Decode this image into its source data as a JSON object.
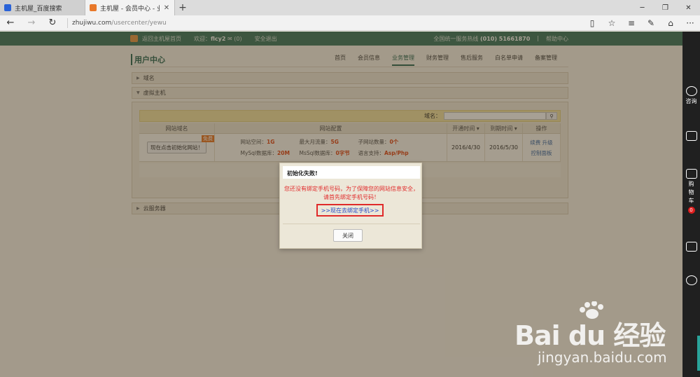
{
  "browser": {
    "tabs": [
      {
        "title": "主机屋_百度搜索",
        "favicon": "baidu-paw-icon"
      },
      {
        "title": "主机屋 - 会员中心 - 业务",
        "favicon": "house-icon"
      }
    ],
    "new_tab": "+",
    "url_host": "zhujiwu.com",
    "url_path": "/usercenter/yewu"
  },
  "site_header": {
    "home_link": "返回主机屋首页",
    "welcome": "欢迎：",
    "username": "flcy2",
    "message_count": "(0)",
    "logout": "安全退出",
    "hotline_label": "全国统一服务热线",
    "hotline": "(010) 51661870",
    "help": "帮助中心"
  },
  "user_center": {
    "title": "用户中心",
    "nav": [
      "首页",
      "会员信息",
      "业务管理",
      "财务管理",
      "售后服务",
      "白名单申请",
      "备案管理"
    ],
    "active_nav": "业务管理"
  },
  "sections": {
    "domain": "域名",
    "vhost": "虚拟主机",
    "cloud": "云服务器"
  },
  "hosting": {
    "search_label": "域名：",
    "columns": [
      "网站域名",
      "网站配置",
      "开通时间 ▾",
      "到期时间 ▾",
      "操作"
    ],
    "row": {
      "init_button": "现在点击初始化网站！",
      "badge": "免费",
      "space_label": "网站空间：",
      "space": "1G",
      "traffic_label": "最大月流量：",
      "traffic": "5G",
      "subsites_label": "子网站数量：",
      "subsites": "0个",
      "mysql_label": "MySql数据库：",
      "mysql": "20M",
      "mssql_label": "MsSql数据库：",
      "mssql": "0字节",
      "lang_label": "语言支持：",
      "lang": "Asp/Php",
      "open_date": "2016/4/30",
      "expire_date": "2016/5/30",
      "ops_1": "续费 升级",
      "ops_2": "控制面板"
    }
  },
  "dialog": {
    "title": "初始化失败!",
    "message": "您还没有绑定手机号码，为了保障您的网站信息安全，请首先绑定手机号码！",
    "link": ">>现在去绑定手机>>",
    "close": "关闭"
  },
  "sidebar": {
    "consult": "咨询",
    "cart": "购物车",
    "cart_count": "0"
  },
  "watermark": {
    "logo": "Bai du 经验",
    "url": "jingyan.baidu.com"
  },
  "colors": {
    "header_green": "#3f7864",
    "accent_red": "#e12a2a",
    "link_blue": "#2749c7",
    "value_orange": "#e04a1c"
  }
}
